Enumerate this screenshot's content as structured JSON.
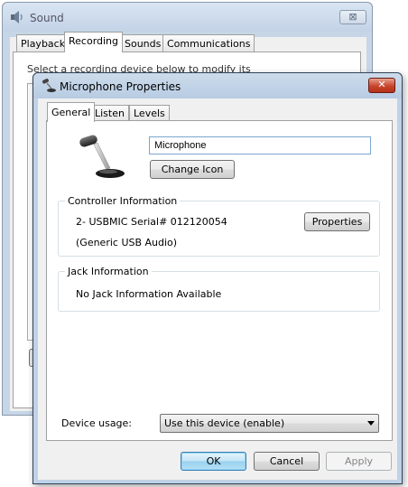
{
  "background_window": {
    "title": "Sound",
    "close_glyph": "⊠",
    "icon": "speaker-icon",
    "tabs": [
      "Playback",
      "Recording",
      "Sounds",
      "Communications"
    ],
    "active_tab": "Recording",
    "partial_text": "Select a recording device below to modify its settings:"
  },
  "dialog": {
    "title": "Microphone Properties",
    "icon": "microphone-icon",
    "close_glyph": "✕",
    "tabs": [
      "General",
      "Listen",
      "Levels"
    ],
    "active_tab": "General",
    "device_icon": "microphone-icon",
    "device_name_value": "Microphone",
    "change_icon_label": "Change Icon",
    "controller": {
      "title": "Controller Information",
      "line1": "2- USBMIC Serial# 012120054",
      "line2": "(Generic USB Audio)",
      "properties_label": "Properties"
    },
    "jack": {
      "title": "Jack Information",
      "text": "No Jack Information Available"
    },
    "device_usage": {
      "label": "Device usage:",
      "selected": "Use this device (enable)"
    },
    "buttons": {
      "ok": "OK",
      "cancel": "Cancel",
      "apply": "Apply"
    }
  },
  "colors": {
    "titlebar": "#c3d3e6",
    "close_active": "#c8452d",
    "default_button_border": "#3c7fb1"
  }
}
